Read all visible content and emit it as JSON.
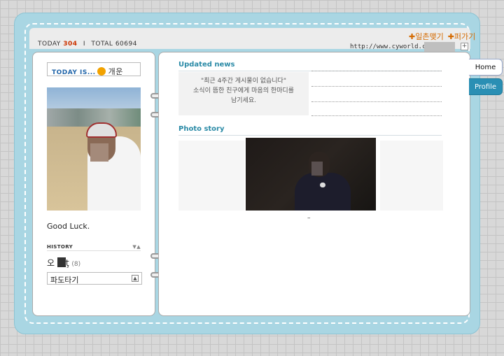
{
  "counter": {
    "today_label": "TODAY",
    "today_value": "304",
    "separator": "I",
    "total_label": "TOTAL",
    "total_value": "60694"
  },
  "header_links": {
    "link1": "✚일촌맺기",
    "link2": "✚퍼가기",
    "plus": "+"
  },
  "url": "http://www.cyworld.com/",
  "profile": {
    "today_is_label": "TODAY IS...",
    "mood": "개운",
    "status_text": "Good Luck.",
    "history_label": "HISTORY",
    "history_arrows": "▼▲",
    "name_first": "오",
    "name_last": "ţ",
    "name_count": "(8)",
    "dropdown_value": "파도타기",
    "dropdown_arrow": "▲"
  },
  "main": {
    "updated_news_title": "Updated news",
    "news_empty_line1": "\"최근 4주간 게시물이 없습니다\"",
    "news_empty_line2": "소식이 뜸한 친구에게 마음의 한마디를",
    "news_empty_line3": "남기세요.",
    "photo_story_title": "Photo story",
    "photo_caption": "–",
    "apple_glyph": ""
  },
  "tabs": {
    "home": "Home",
    "profile": "Profile"
  },
  "colors": {
    "accent": "#2a8aa6",
    "book": "#a9d6e3",
    "link": "#d46a00"
  }
}
